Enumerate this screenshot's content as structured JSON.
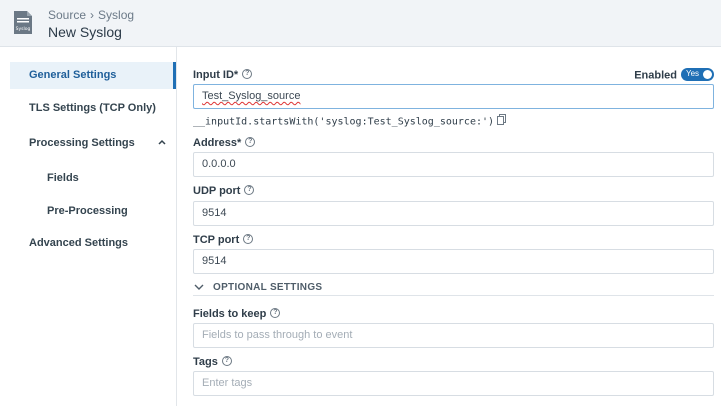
{
  "header": {
    "icon": "syslog-icon",
    "icon_label": "Syslog",
    "breadcrumb_parent": "Source",
    "breadcrumb_separator": "›",
    "breadcrumb_current": "Syslog",
    "title": "New Syslog"
  },
  "sidebar": {
    "items": [
      {
        "label": "General Settings",
        "active": true
      },
      {
        "label": "TLS Settings (TCP Only)"
      },
      {
        "label": "Processing Settings",
        "expanded": true
      },
      {
        "label": "Fields"
      },
      {
        "label": "Pre-Processing"
      },
      {
        "label": "Advanced Settings"
      }
    ]
  },
  "form": {
    "input_id": {
      "label": "Input ID*",
      "value": "Test_Syslog_source"
    },
    "enabled": {
      "label": "Enabled",
      "toggle_text": "Yes",
      "on": true
    },
    "expression": "__inputId.startsWith('syslog:Test_Syslog_source:')",
    "address": {
      "label": "Address*",
      "value": "0.0.0.0"
    },
    "udp_port": {
      "label": "UDP port",
      "value": "9514"
    },
    "tcp_port": {
      "label": "TCP port",
      "value": "9514"
    },
    "optional_settings": {
      "label": "OPTIONAL SETTINGS"
    },
    "fields_to_keep": {
      "label": "Fields to keep",
      "placeholder": "Fields to pass through to event"
    },
    "tags": {
      "label": "Tags",
      "placeholder": "Enter tags"
    }
  },
  "colors": {
    "accent": "#1f6fb5",
    "active_bg": "#e9f2f9",
    "header_bg": "#f1f4f7"
  }
}
